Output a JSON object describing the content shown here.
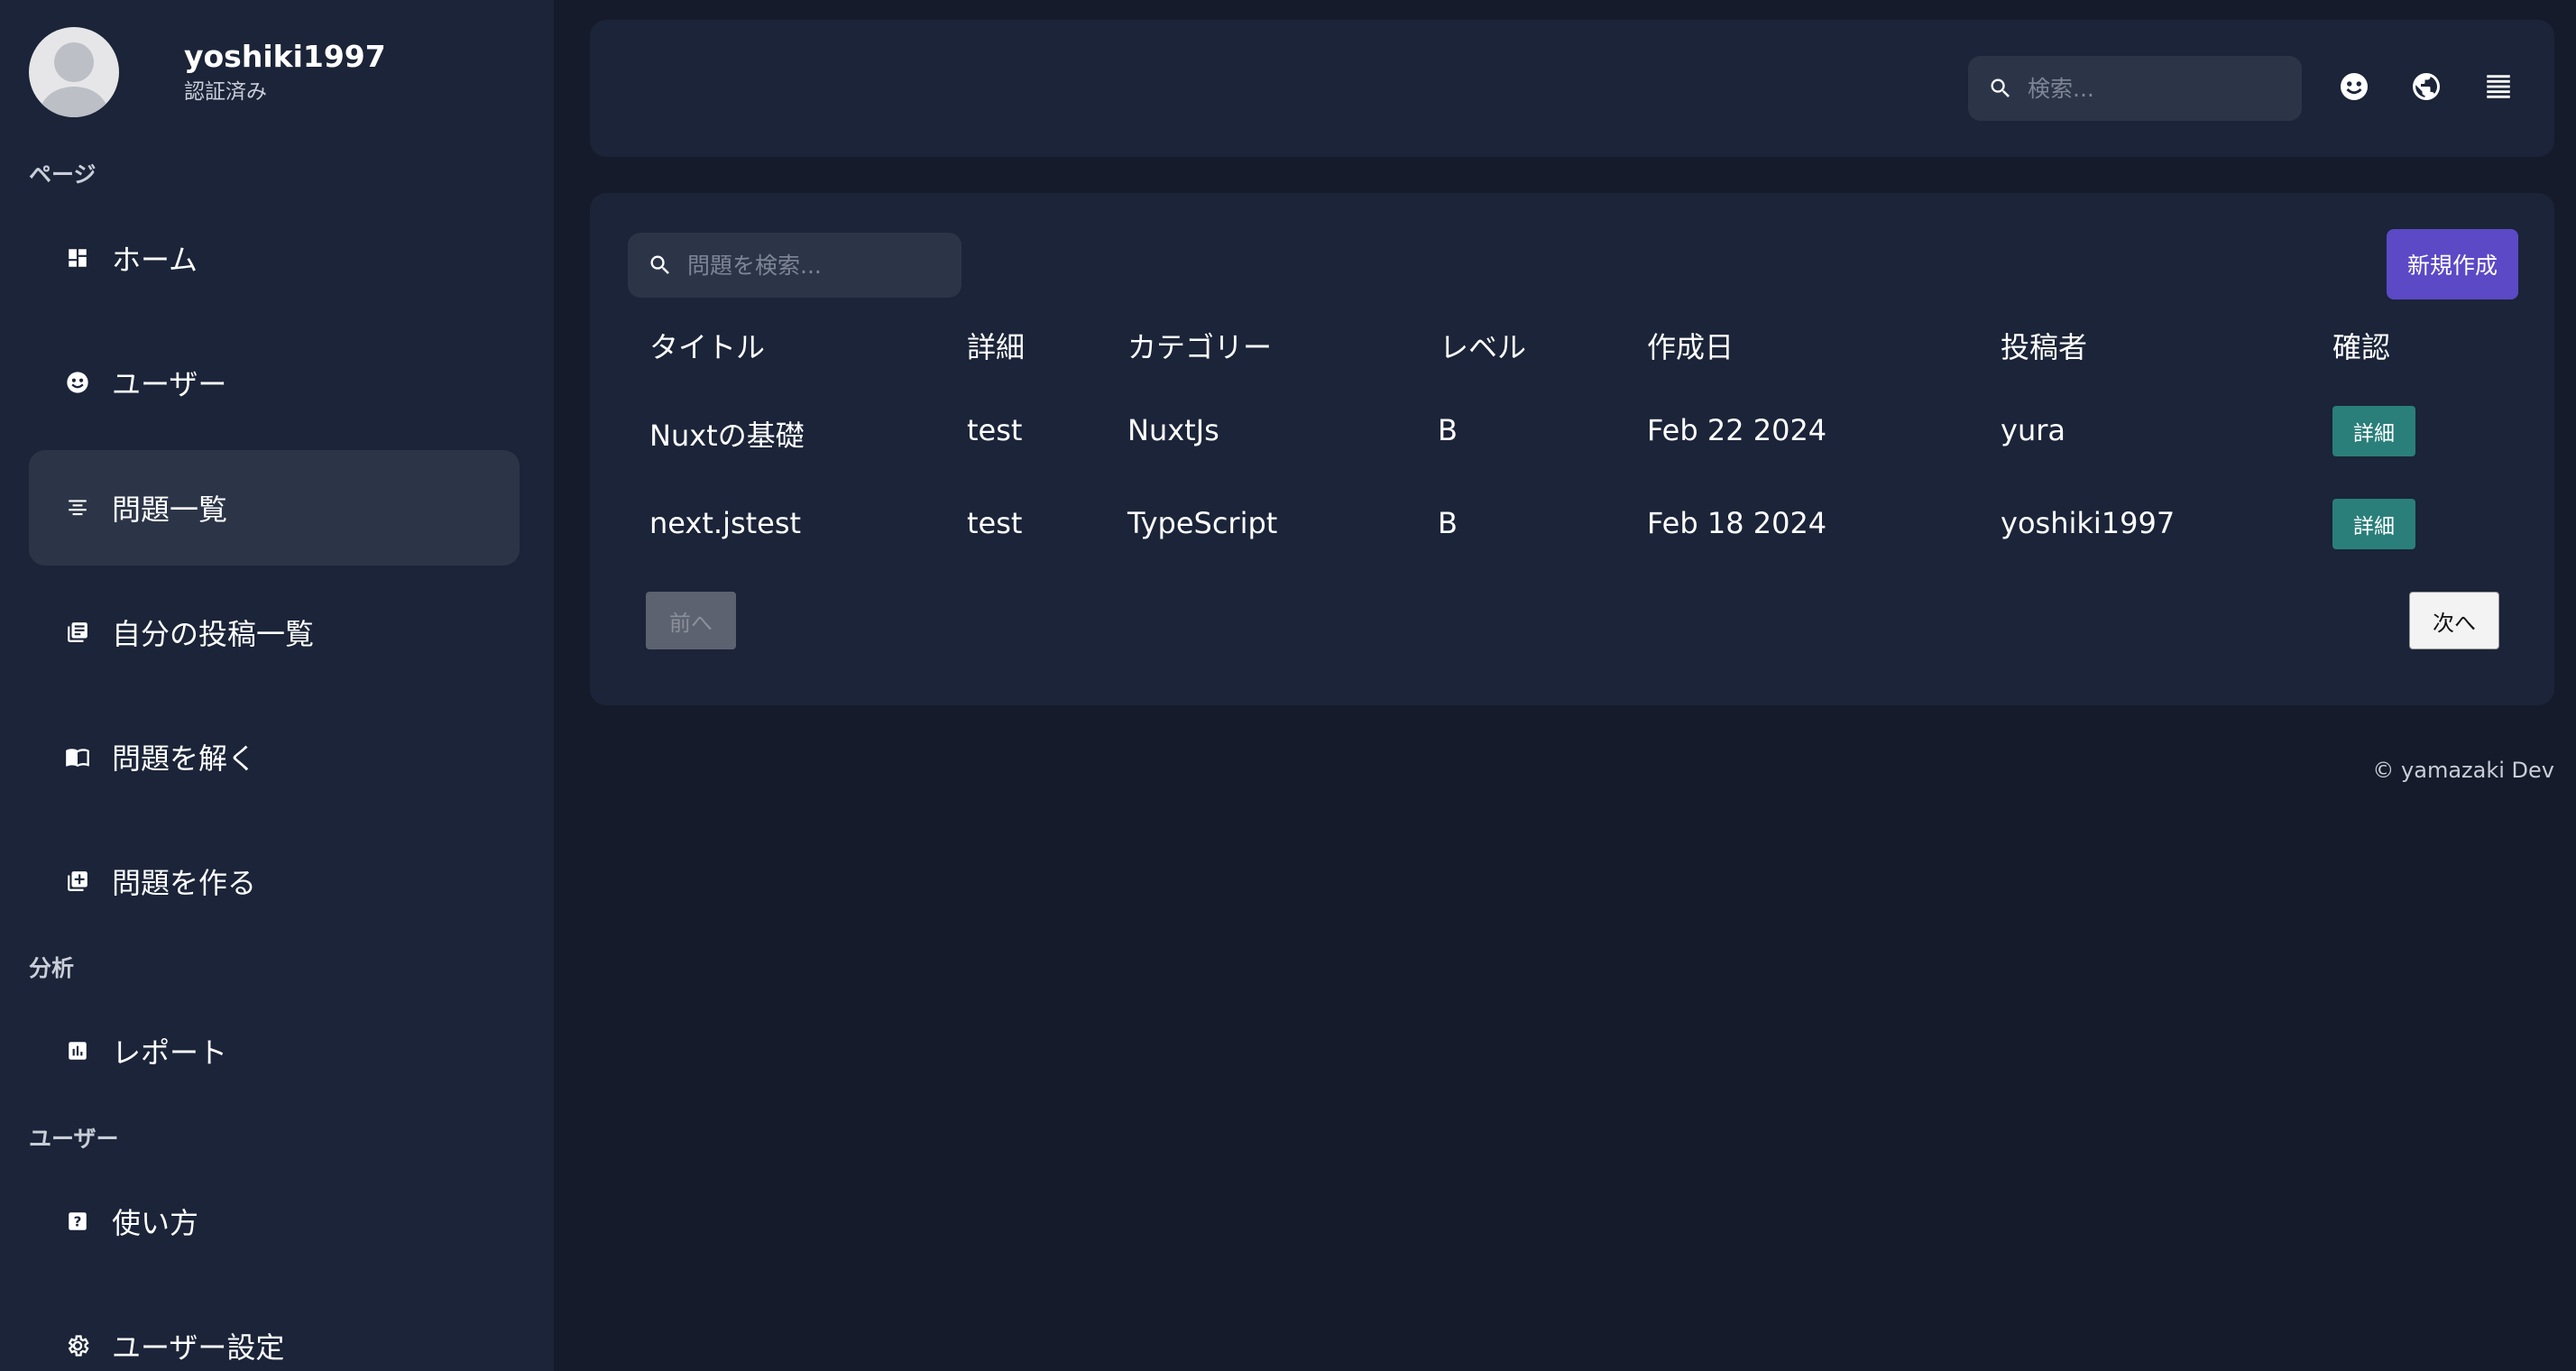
{
  "profile": {
    "username": "yoshiki1997",
    "status": "認証済み"
  },
  "sidebar": {
    "sections": [
      {
        "label": "ページ"
      },
      {
        "label": "分析"
      },
      {
        "label": "ユーザー"
      }
    ],
    "items": [
      {
        "label": "ホーム",
        "icon": "dashboard-icon"
      },
      {
        "label": "ユーザー",
        "icon": "user-face-icon"
      },
      {
        "label": "問題一覧",
        "icon": "list-icon",
        "active": true
      },
      {
        "label": "自分の投稿一覧",
        "icon": "library-icon"
      },
      {
        "label": "問題を解く",
        "icon": "book-icon"
      },
      {
        "label": "問題を作る",
        "icon": "add-box-icon"
      },
      {
        "label": "レポート",
        "icon": "report-icon"
      },
      {
        "label": "使い方",
        "icon": "help-icon"
      },
      {
        "label": "ユーザー設定",
        "icon": "gear-icon"
      }
    ]
  },
  "topbar": {
    "search_placeholder": "検索...",
    "icons": [
      "user-face-icon",
      "globe-icon",
      "menu-icon"
    ]
  },
  "questions": {
    "search_placeholder": "問題を検索...",
    "new_button": "新規作成",
    "columns": [
      "タイトル",
      "詳細",
      "カテゴリー",
      "レベル",
      "作成日",
      "投稿者",
      "確認"
    ],
    "rows": [
      {
        "title": "Nuxtの基礎",
        "detail": "test",
        "category": "NuxtJs",
        "level": "B",
        "date": "Feb 22 2024",
        "author": "yura",
        "action": "詳細"
      },
      {
        "title": "next.jstest",
        "detail": "test",
        "category": "TypeScript",
        "level": "B",
        "date": "Feb 18 2024",
        "author": "yoshiki1997",
        "action": "詳細"
      }
    ],
    "prev_button": "前へ",
    "next_button": "次へ"
  },
  "footer": {
    "text": "© yamazaki Dev"
  },
  "colors": {
    "background": "#151b2b",
    "panel": "#1b2438",
    "active_item": "#2c3548",
    "primary": "#5b49c6",
    "detail_button": "#2a7f7a"
  }
}
